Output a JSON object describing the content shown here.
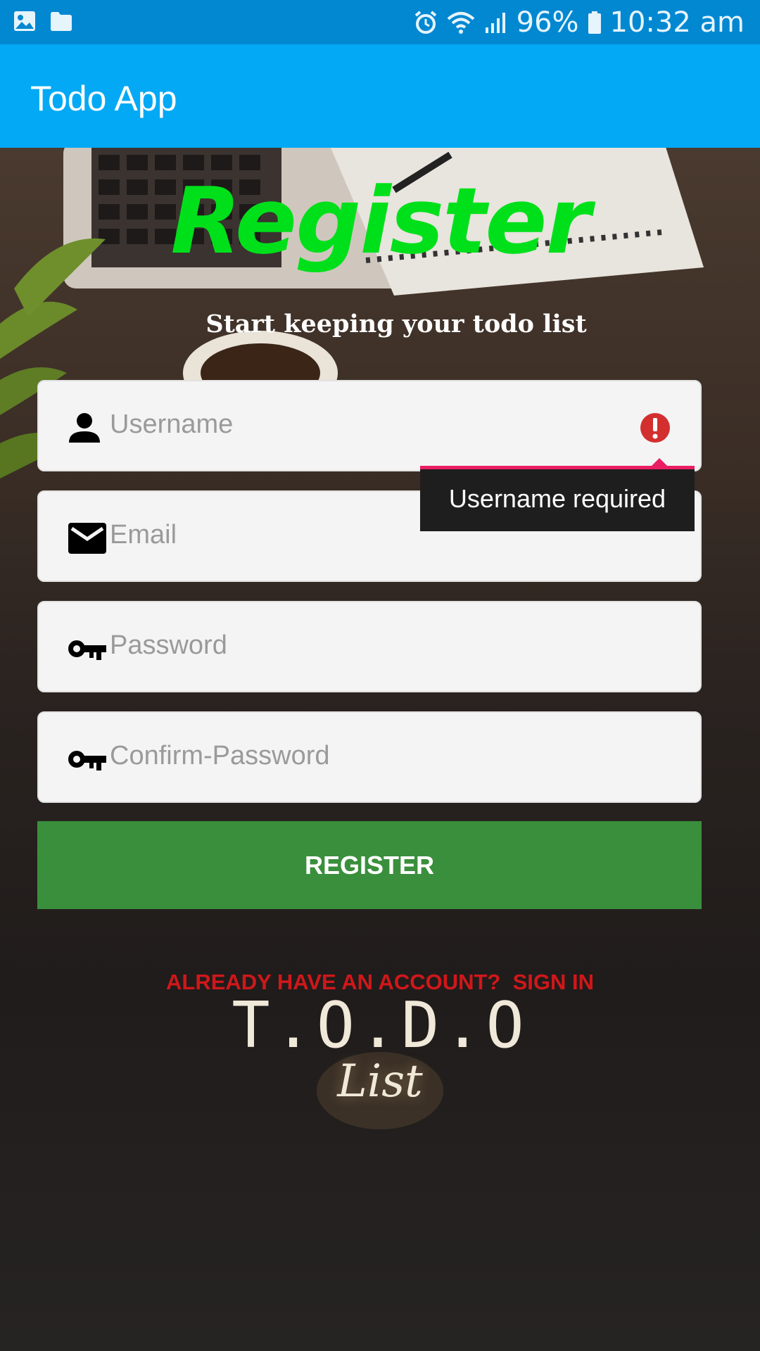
{
  "status_bar": {
    "battery": "96%",
    "time": "10:32 am",
    "icons": [
      "gallery-icon",
      "folder-icon",
      "alarm-icon",
      "wifi-icon",
      "signal-icon",
      "battery-icon"
    ]
  },
  "app_bar": {
    "title": "Todo App"
  },
  "header": {
    "title": "Register",
    "subtitle": "Start keeping your todo list"
  },
  "form": {
    "username": {
      "placeholder": "Username",
      "icon": "person-icon",
      "error_icon": "error-icon"
    },
    "email": {
      "placeholder": "Email",
      "icon": "mail-icon"
    },
    "password": {
      "placeholder": "Password",
      "icon": "key-icon"
    },
    "confirm_password": {
      "placeholder": "Confirm-Password",
      "icon": "key-icon"
    },
    "error_tooltip": "Username required",
    "register_label": "REGISTER"
  },
  "footer": {
    "signin_text": "ALREADY HAVE AN ACCOUNT?  SIGN IN",
    "logo_title": "T.O.D.O",
    "logo_subtitle": "List"
  },
  "colors": {
    "status_bar": "#0288d1",
    "app_bar": "#03a9f4",
    "register_title": "#00e01a",
    "register_button": "#3a8f3c",
    "signin_link": "#d0171a",
    "error": "#d32f2f",
    "tooltip_accent": "#e91e63"
  }
}
